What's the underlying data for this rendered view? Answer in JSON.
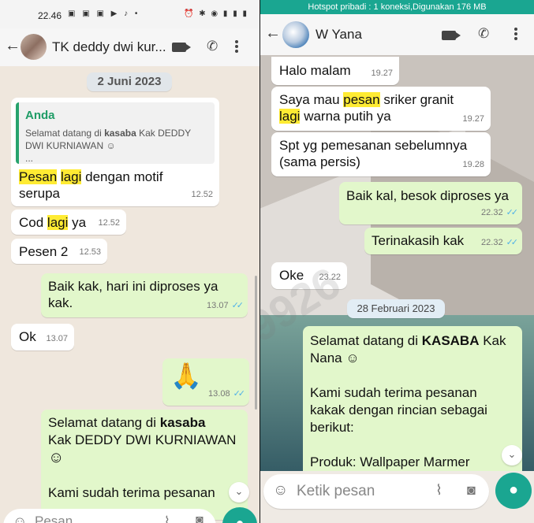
{
  "left": {
    "status": {
      "time": "22.46",
      "left_icons": "▣ ▣ ▣ ▶ ♪ •",
      "right_icons": "⏰ ✱ ◉ ▮ ▮ ▮"
    },
    "header": {
      "name": "TK deddy dwi kur..."
    },
    "date": "2 Juni 2023",
    "messages": [
      {
        "quote_name": "Anda",
        "quote_text_1": "Selamat datang di ",
        "quote_bold": "kasaba",
        "quote_text_2": " Kak DEDDY DWI KURNIAWAN ☺",
        "quote_more": "...",
        "hl1": "Pesan",
        "hl2": "lagi",
        "text_rest_1": " dengan motif",
        "text_rest_2": "serupa",
        "time": "12.52"
      },
      {
        "text": "Cod ",
        "hl": "lagi",
        "text_rest": " ya",
        "time": "12.52"
      },
      {
        "text": "Pesen 2",
        "time": "12.53"
      },
      {
        "text_1": "Baik kak, hari ini diproses ya",
        "text_2": "kak.",
        "time": "13.07"
      },
      {
        "text": "Ok",
        "time": "13.07"
      },
      {
        "text": "🙏",
        "time": "13.08"
      },
      {
        "text_1": "Selamat datang di ",
        "bold": "kasaba",
        "text_2": "Kak DEDDY DWI KURNIAWAN",
        "emoji": "☺",
        "text_3": "Kami sudah terima pesanan"
      }
    ],
    "input_placeholder": "Pesan"
  },
  "right": {
    "status": {
      "hotspot": "Hotspot pribadi : 1 koneksi,Digunakan 176 MB"
    },
    "header": {
      "name": "W Yana"
    },
    "messages": [
      {
        "text": "Halo malam",
        "time": "19.27"
      },
      {
        "text_1": "Saya mau ",
        "hl1": "pesan",
        "text_2": " sriker granit",
        "hl2": "lagi",
        "text_3": " warna putih ya",
        "time": "19.27"
      },
      {
        "text_1": "Spt yg pemesanan sebelumnya",
        "text_2": "(sama persis)",
        "time": "19.28"
      },
      {
        "text": "Baik kal, besok diproses ya",
        "time": "22.32"
      },
      {
        "text": "Terinakasih kak",
        "time": "22.32"
      },
      {
        "text": "Oke",
        "time": "23.22"
      },
      {
        "text_1": "Selamat datang di ",
        "bold": "KASABA",
        "text_2": " Kak",
        "text_3": "Nana ☺",
        "text_4": "Kami sudah terima pesanan",
        "text_5": "kakak dengan rincian sebagai",
        "text_6": "berikut:",
        "text_7": "Produk: Wallpaper Marmer"
      }
    ],
    "date": "28 Februari 2023",
    "input_placeholder": "Ketik pesan"
  },
  "watermark": "082177999926",
  "colors": {
    "accent": "#1aa691",
    "outgoing": "#e2f7cb",
    "highlight": "#ffeb33",
    "ticks": "#4fb1e8"
  }
}
